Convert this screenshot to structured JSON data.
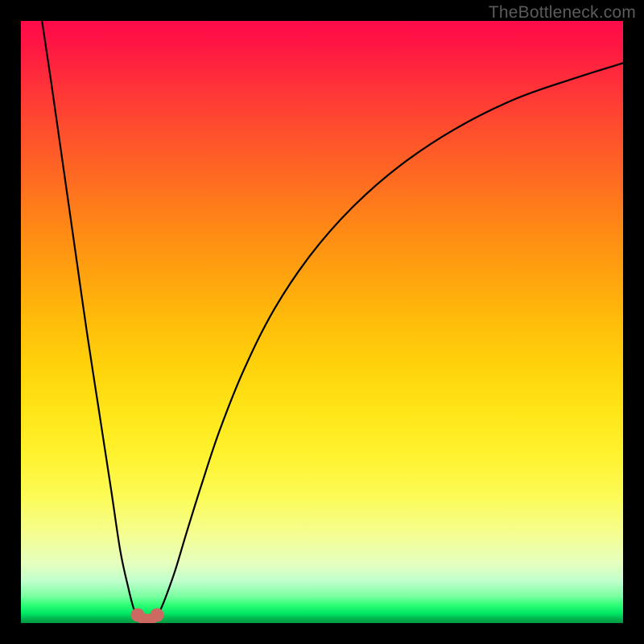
{
  "watermark": "TheBottleneck.com",
  "chart_data": {
    "type": "line",
    "title": "",
    "xlabel": "",
    "ylabel": "",
    "xlim": [
      0,
      100
    ],
    "ylim": [
      0,
      100
    ],
    "grid": false,
    "curve_color": "#000000",
    "series": [
      {
        "name": "left-branch",
        "x": [
          3.5,
          5,
          7,
          9,
          11,
          13,
          15,
          16.5,
          17.8,
          18.7,
          19.4
        ],
        "values": [
          100,
          90,
          76,
          62,
          48,
          35,
          22,
          12,
          6,
          2.5,
          1.3
        ]
      },
      {
        "name": "right-branch",
        "x": [
          22.6,
          23.3,
          24.3,
          25.7,
          27.5,
          30,
          33,
          37,
          42,
          48,
          55,
          63,
          72,
          82,
          92,
          100
        ],
        "values": [
          1.3,
          2.5,
          5,
          9,
          15,
          23,
          32,
          42,
          52,
          61,
          69,
          76,
          82,
          87,
          90.5,
          93
        ]
      }
    ],
    "markers": {
      "color": "#cc6a62",
      "points": [
        {
          "x": 19.4,
          "y": 1.3
        },
        {
          "x": 22.6,
          "y": 1.3
        }
      ],
      "connector": {
        "from_x": 19.4,
        "to_x": 22.6,
        "y": 0.7
      }
    },
    "gradient_stops": [
      {
        "pct": 0,
        "color": "#ff0b4a"
      },
      {
        "pct": 50,
        "color": "#ffbd0a"
      },
      {
        "pct": 79,
        "color": "#fcfb56"
      },
      {
        "pct": 100,
        "color": "#009a42"
      }
    ]
  }
}
